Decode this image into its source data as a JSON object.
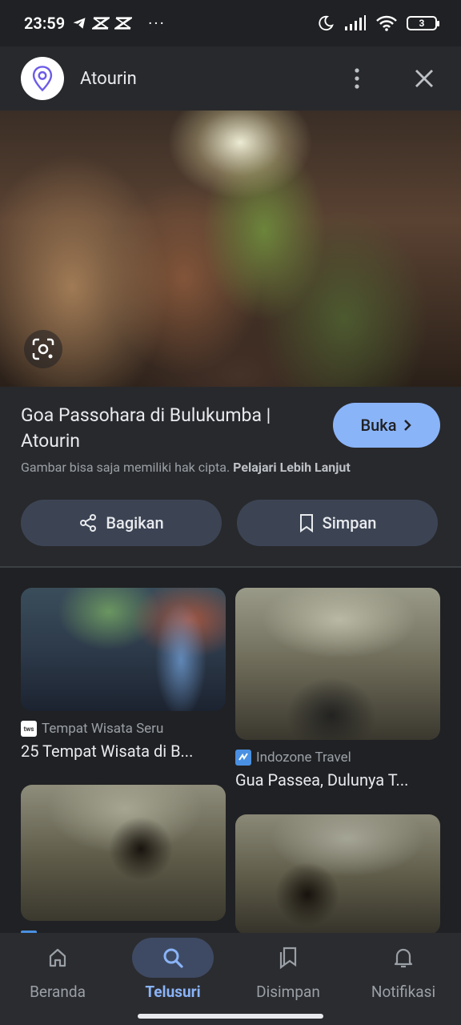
{
  "status_bar": {
    "time": "23:59",
    "battery": "3",
    "more": "···"
  },
  "header": {
    "site_name": "Atourin",
    "site_logo_icon": "location-pin-icon"
  },
  "hero": {
    "description_icon": "lens-icon"
  },
  "info": {
    "title": "Goa Passohara di Bulukumba | Atourin",
    "open_label": "Buka",
    "copyright_text": "Gambar bisa saja memiliki hak cipta.",
    "learn_more": "Pelajari Lebih Lanjut",
    "share_label": "Bagikan",
    "save_label": "Simpan"
  },
  "related": [
    {
      "source": "Tempat Wisata Seru",
      "source_icon_text": "tws",
      "title": "25 Tempat Wisata di B..."
    },
    {
      "source": "Indozone Travel",
      "source_icon_text": "",
      "title": "Gua Passea, Dulunya T..."
    },
    {
      "source": "",
      "source_icon_text": "",
      "title": ""
    },
    {
      "source": "",
      "source_icon_text": "",
      "title": ""
    }
  ],
  "bottom_nav": {
    "items": [
      {
        "label": "Beranda",
        "icon": "home-icon"
      },
      {
        "label": "Telusuri",
        "icon": "search-icon"
      },
      {
        "label": "Disimpan",
        "icon": "collections-icon"
      },
      {
        "label": "Notifikasi",
        "icon": "bell-icon"
      }
    ],
    "active_index": 1
  },
  "colors": {
    "accent": "#8ab4f8",
    "background": "#202124",
    "surface": "#28292c",
    "button": "#3c4454"
  }
}
